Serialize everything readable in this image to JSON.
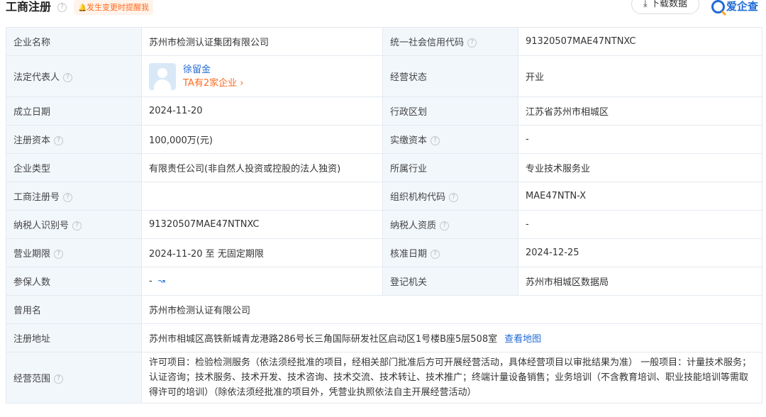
{
  "header": {
    "title": "工商注册",
    "notice_icon": "bell-icon",
    "notice": "发生变更时提醒我",
    "download_label": "下载数据",
    "download_icon": "download-icon",
    "logo_text": "爱企查",
    "colors": {
      "link": "#1f6bd6",
      "accent": "#ff6a1e",
      "label_bg": "#f2f7fc"
    }
  },
  "table": {
    "company_name_label": "企业名称",
    "company_name": "苏州市检测认证集团有限公司",
    "credit_code_label": "统一社会信用代码",
    "credit_code": "91320507MAE47NTNXC",
    "legal_rep_label": "法定代表人",
    "legal_rep_name": "徐留金",
    "legal_rep_companies": "TA有2家企业",
    "status_label": "经营状态",
    "status": "开业",
    "established_label": "成立日期",
    "established": "2024-11-20",
    "region_label": "行政区划",
    "region": "江苏省苏州市相城区",
    "reg_capital_label": "注册资本",
    "reg_capital": "100,000万(元)",
    "paid_capital_label": "实缴资本",
    "paid_capital": "-",
    "company_type_label": "企业类型",
    "company_type": "有限责任公司(非自然人投资或控股的法人独资)",
    "industry_label": "所属行业",
    "industry": "专业技术服务业",
    "reg_number_label": "工商注册号",
    "reg_number": "",
    "org_code_label": "组织机构代码",
    "org_code": "MAE47NTN-X",
    "taxpayer_id_label": "纳税人识别号",
    "taxpayer_id": "91320507MAE47NTNXC",
    "taxpayer_qual_label": "纳税人资质",
    "taxpayer_qual": "-",
    "term_label": "营业期限",
    "term": "2024-11-20 至 无固定期限",
    "approval_date_label": "核准日期",
    "approval_date": "2024-12-25",
    "insured_label": "参保人数",
    "insured": "-",
    "registrar_label": "登记机关",
    "registrar": "苏州市相城区数据局",
    "former_name_label": "曾用名",
    "former_name": "苏州市检测认证有限公司",
    "address_label": "注册地址",
    "address": "苏州市相城区高铁新城青龙港路286号长三角国际研发社区启动区1号楼B座5层508室",
    "view_map": "查看地图",
    "scope_label": "经营范围",
    "scope": "许可项目：检验检测服务（依法须经批准的项目，经相关部门批准后方可开展经营活动，具体经营项目以审批结果为准） 一般项目：计量技术服务；认证咨询；技术服务、技术开发、技术咨询、技术交流、技术转让、技术推广；终端计量设备销售；业务培训（不含教育培训、职业技能培训等需取得许可的培训）（除依法须经批准的项目外，凭营业执照依法自主开展经营活动）"
  }
}
